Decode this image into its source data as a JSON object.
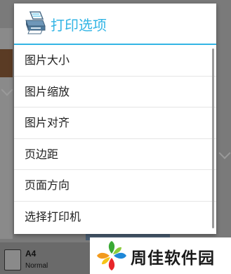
{
  "dialog": {
    "title": "打印选项",
    "options": [
      {
        "label": "图片大小"
      },
      {
        "label": "图片缩放"
      },
      {
        "label": "图片对齐"
      },
      {
        "label": "页边距"
      },
      {
        "label": "页面方向"
      },
      {
        "label": "选择打印机"
      }
    ],
    "accent_color": "#33b5e5"
  },
  "background": {
    "paper_size": "A4",
    "paper_mode": "Normal"
  },
  "watermark": {
    "text": "周佳软件园"
  },
  "icons": {
    "header": "printer-icon",
    "watermark": "pinwheel-logo"
  }
}
